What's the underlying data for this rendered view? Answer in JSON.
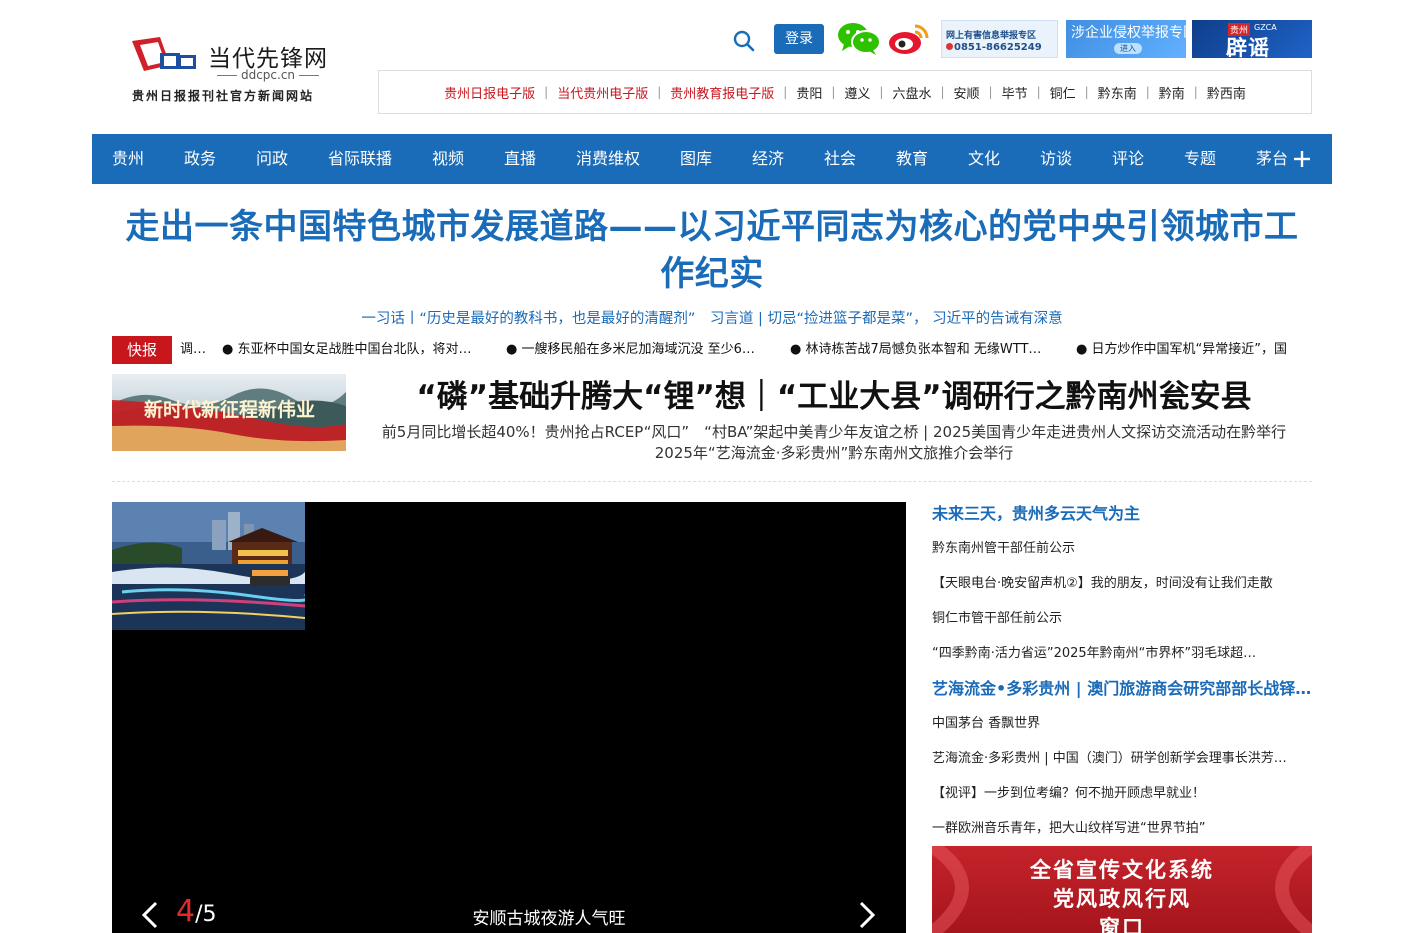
{
  "header": {
    "logo": {
      "title": "当代先锋网",
      "domain": "ddcpc.cn",
      "subtitle": "贵州日报报刊社官方新闻网站"
    },
    "login_label": "登录",
    "banners": {
      "report": {
        "line1": "网上有害信息举报专区",
        "line2": "0851-86625249"
      },
      "corp": {
        "line1": "涉企业侵权举报专区",
        "line2": "进入"
      },
      "rumor": {
        "tag": "贵州",
        "tag2": "GZCA",
        "big": "辟谣"
      }
    }
  },
  "topnav": [
    {
      "label": "贵州日报电子版",
      "red": true
    },
    {
      "label": "当代贵州电子版",
      "red": true
    },
    {
      "label": "贵州教育报电子版",
      "red": true
    },
    {
      "label": "贵阳",
      "red": false
    },
    {
      "label": "遵义",
      "red": false
    },
    {
      "label": "六盘水",
      "red": false
    },
    {
      "label": "安顺",
      "red": false
    },
    {
      "label": "毕节",
      "red": false
    },
    {
      "label": "铜仁",
      "red": false
    },
    {
      "label": "黔东南",
      "red": false
    },
    {
      "label": "黔南",
      "red": false
    },
    {
      "label": "黔西南",
      "red": false
    }
  ],
  "mainnav": [
    "贵州",
    "政务",
    "问政",
    "省际联播",
    "视频",
    "直播",
    "消费维权",
    "图库",
    "经济",
    "社会",
    "教育",
    "文化",
    "访谈",
    "评论",
    "专题",
    "茅台"
  ],
  "headline": "走出一条中国特色城市发展道路——以习近平同志为核心的党中央引领城市工作纪实",
  "sublinks": "一习话丨“历史是最好的教科书，也是最好的清醒剂”　习言道 | 切忌“捡进篮子都是菜”， 习近平的告诫有深意",
  "flash": {
    "label": "快报",
    "items": [
      "调…",
      "● 东亚杯中国女足战胜中国台北队，将对…",
      "● 一艘移民船在多米尼加海域沉没 至少6…",
      "● 林诗栋苦战7局憾负张本智和 无缘WTT…",
      "● 日方炒作中国军机“异常接近”，国"
    ]
  },
  "feature": {
    "banner_text": "新时代新征程新伟业",
    "title": "“磷”基础升腾大“锂”想｜“工业大县”调研行之黔南州瓮安县",
    "sub": "前5月同比增长超40%！贵州抢占RCEP“风口”　“村BA”架起中美青少年友谊之桥 | 2025美国青少年走进贵州人文探访交流活动在黔举行　2025年“艺海流金·多彩贵州”黔东南州文旅推介会举行"
  },
  "slideshow": {
    "current": "4",
    "total": "/5",
    "caption": "安顺古城夜游人气旺"
  },
  "news": [
    {
      "text": "未来三天，贵州多云天气为主",
      "hl": true
    },
    {
      "text": "黔东南州管干部任前公示",
      "hl": false
    },
    {
      "text": "【天眼电台·晚安留声机②】我的朋友，时间没有让我们走散",
      "hl": false
    },
    {
      "text": "铜仁市管干部任前公示",
      "hl": false
    },
    {
      "text": "“四季黔南·活力省运”2025年黔南州“市界杯”羽毛球超…",
      "hl": false
    },
    {
      "text": "艺海流金•多彩贵州 | 澳门旅游商会研究部部长战铎…",
      "hl": true
    },
    {
      "text": "中国茅台 香飘世界",
      "hl": false
    },
    {
      "text": "艺海流金·多彩贵州 | 中国（澳门）研学创新学会理事长洪芳…",
      "hl": false
    },
    {
      "text": "【视评】一步到位考编？何不抛开顾虑早就业！",
      "hl": false
    },
    {
      "text": "一群欧洲音乐青年，把大山纹样写进“世界节拍”",
      "hl": false
    }
  ],
  "culture_banner": {
    "line1": "全省宣传文化系统",
    "line2": "党风政风行风",
    "line3": "窗口"
  },
  "colors": {
    "brand_blue": "#1a6bb8",
    "flash_red": "#c8161d"
  }
}
